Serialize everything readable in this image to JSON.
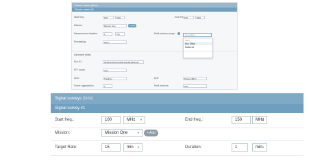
{
  "mini": {
    "section_title": "Scene name",
    "section_hide": "(hide)",
    "sub_title": "Scene name #1",
    "start_freq_label": "Start freq:",
    "start_freq_value": "100",
    "start_freq_unit": "MHz",
    "end_freq_label": "End freq:",
    "end_freq_value": "150",
    "end_freq_unit": "MHz",
    "mission_label": "Mission:",
    "mission_value": "Mission One",
    "add_label": "+ Add",
    "measurement_label": "Measurement duration:",
    "measurement_value": "1",
    "measurement_unit": "min",
    "multi_label": "Multi-mission scope:",
    "search_placeholder": "Non Office",
    "dropdown_items": [
      "none",
      "Non Office",
      "Balanced"
    ],
    "processing_label": "Processing:",
    "processing_value": "Mean",
    "advanced_label": "Advanced (hide)",
    "run_id_label": "Run ID:",
    "run_id_value": "54d5b4c4f6ea4b9fb54e3e8d3dfab4a4",
    "fft_label": "FFT mode:",
    "fft_value": "auto",
    "agc_label": "AGC:",
    "agc_value": "Tracking",
    "unit_label": "Unit:",
    "unit_value": "Power (dBm)",
    "average_label": "Power aggregation:",
    "average_value": "1",
    "multi_antenna_label": "Multi-antenna:",
    "multi_antenna_value": "auto"
  },
  "main": {
    "section_title": "Signal surveys",
    "section_hide": "(hide)",
    "sub_title": "Signal survey #1",
    "start_freq_label": "Start freq.:",
    "start_freq_value": "100",
    "start_freq_unit": "MHz",
    "end_freq_label": "End freq.:",
    "end_freq_value": "150",
    "end_freq_unit": "MHz",
    "mission_label": "Mission:",
    "mission_value": "Mission One",
    "add_label": "+ Add",
    "target_rate_label": "Target Rate:",
    "target_rate_value": "15",
    "target_rate_unit": "min",
    "duration_label": "Duration:",
    "duration_value": "1",
    "duration_unit": "min"
  }
}
